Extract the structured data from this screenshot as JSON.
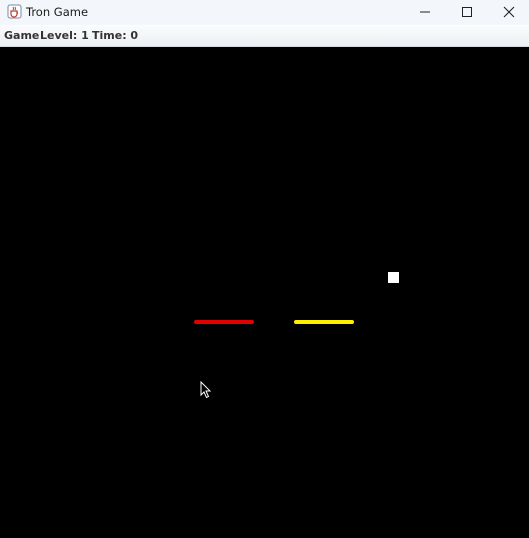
{
  "window": {
    "title": "Tron Game",
    "icon": "java-cup-icon",
    "controls": [
      "minimize-icon",
      "maximize-icon",
      "close-icon"
    ]
  },
  "menubar": {
    "game_menu": "Game",
    "level_text": "Level: 1",
    "time_text": "Time: 0"
  },
  "board": {
    "background": "#000000",
    "players": [
      {
        "color": "#e00000"
      },
      {
        "color": "#ffee00"
      }
    ],
    "powerup_color": "#ffffff"
  }
}
